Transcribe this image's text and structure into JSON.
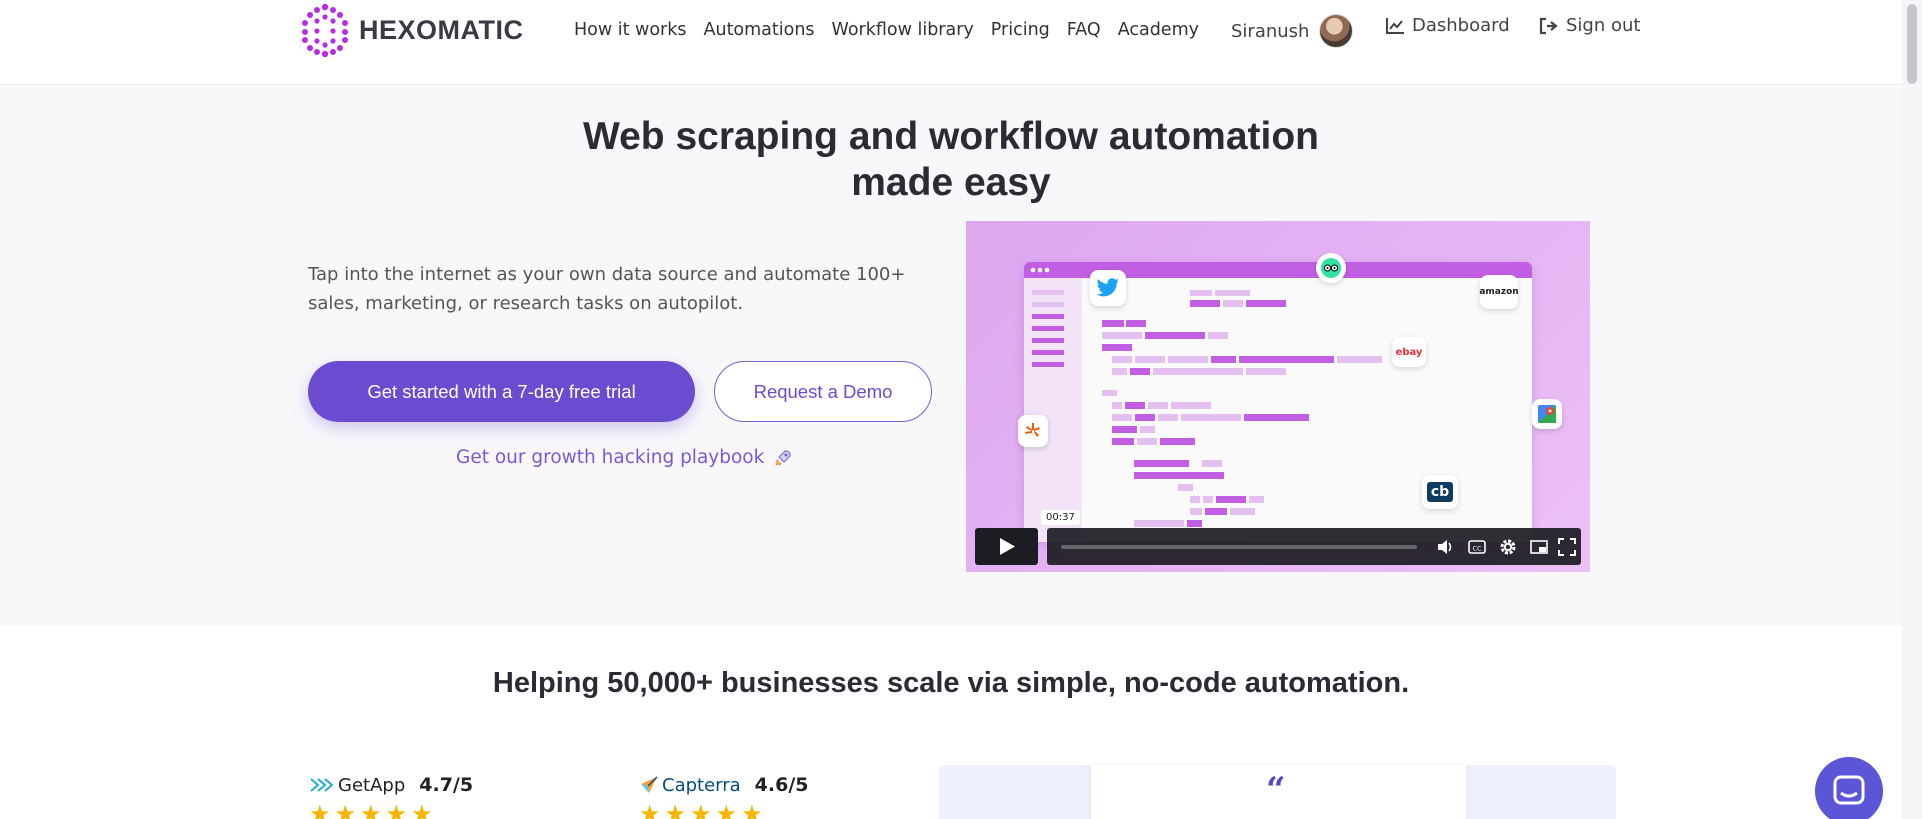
{
  "header": {
    "logo_text": "HEXOMATIC",
    "nav": [
      "How it works",
      "Automations",
      "Workflow library",
      "Pricing",
      "FAQ",
      "Academy"
    ],
    "user_name": "Siranush",
    "dashboard_label": "Dashboard",
    "signout_label": "Sign out"
  },
  "hero": {
    "title_line1": "Web scraping and workflow automation",
    "title_line2": "made easy",
    "subtitle_line1": "Tap into the internet as your own data source and automate 100+",
    "subtitle_line2": "sales, marketing, or research tasks on autopilot.",
    "primary_cta": "Get started with a 7-day free trial",
    "secondary_cta": "Request a Demo",
    "playbook_link": "Get our growth hacking playbook",
    "video": {
      "time": "00:37",
      "brands": {
        "amazon": "amazon",
        "ebay": "ebay",
        "cb": "cb"
      }
    }
  },
  "social_proof": {
    "heading": "Helping 50,000+ businesses scale via simple, no-code automation.",
    "ratings": [
      {
        "name": "GetApp",
        "score": "4.7/5"
      },
      {
        "name": "Capterra",
        "score": "4.6/5"
      }
    ],
    "quote_mark": "“"
  },
  "colors": {
    "brand": "#6b4bd0",
    "logo": "#b52ee6"
  }
}
